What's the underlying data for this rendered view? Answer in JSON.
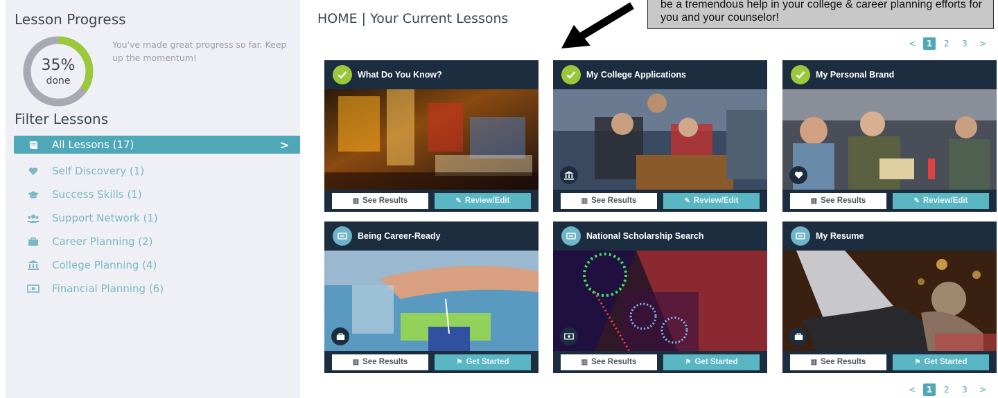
{
  "sidebar": {
    "progress_title": "Lesson Progress",
    "progress_percent_label": "35%",
    "progress_done_label": "done",
    "progress_fraction": 0.35,
    "progress_message": "You've made great progress so far. Keep up the momentum!",
    "filter_title": "Filter Lessons",
    "filters": [
      {
        "label": "All Lessons (17)",
        "icon": "book-icon",
        "active": true
      },
      {
        "label": "Self Discovery (1)",
        "icon": "heart-icon",
        "active": false
      },
      {
        "label": "Success Skills (1)",
        "icon": "graduation-cap-icon",
        "active": false
      },
      {
        "label": "Support Network (1)",
        "icon": "users-icon",
        "active": false
      },
      {
        "label": "Career Planning (2)",
        "icon": "briefcase-icon",
        "active": false
      },
      {
        "label": "College Planning (4)",
        "icon": "institution-icon",
        "active": false
      },
      {
        "label": "Financial Planning (6)",
        "icon": "money-icon",
        "active": false
      }
    ]
  },
  "main": {
    "title": "HOME | Your Current Lessons",
    "callout_text": "be a tremendous help in your college & career planning efforts for you and your counselor!",
    "pagination": {
      "prev": "<",
      "pages": [
        "1",
        "2",
        "3"
      ],
      "current": "1",
      "next": ">"
    },
    "cards": [
      {
        "title": "What Do You Know?",
        "status": "done",
        "category_icon": "",
        "results_label": "See Results",
        "action_label": "Review/Edit"
      },
      {
        "title": "My College Applications",
        "status": "done",
        "category_icon": "institution-icon",
        "results_label": "See Results",
        "action_label": "Review/Edit"
      },
      {
        "title": "My Personal Brand",
        "status": "done",
        "category_icon": "heart-icon",
        "results_label": "See Results",
        "action_label": "Review/Edit"
      },
      {
        "title": "Being Career-Ready",
        "status": "todo",
        "category_icon": "briefcase-icon",
        "results_label": "See Results",
        "action_label": "Get Started"
      },
      {
        "title": "National Scholarship Search",
        "status": "todo",
        "category_icon": "money-icon",
        "results_label": "See Results",
        "action_label": "Get Started"
      },
      {
        "title": "My Resume",
        "status": "todo",
        "category_icon": "briefcase-icon",
        "results_label": "See Results",
        "action_label": "Get Started"
      }
    ]
  },
  "colors": {
    "accent": "#4fa8b8",
    "done_badge": "#9ac83a",
    "card_bg": "#1c2d40",
    "sidebar_bg": "#eff0f5"
  }
}
